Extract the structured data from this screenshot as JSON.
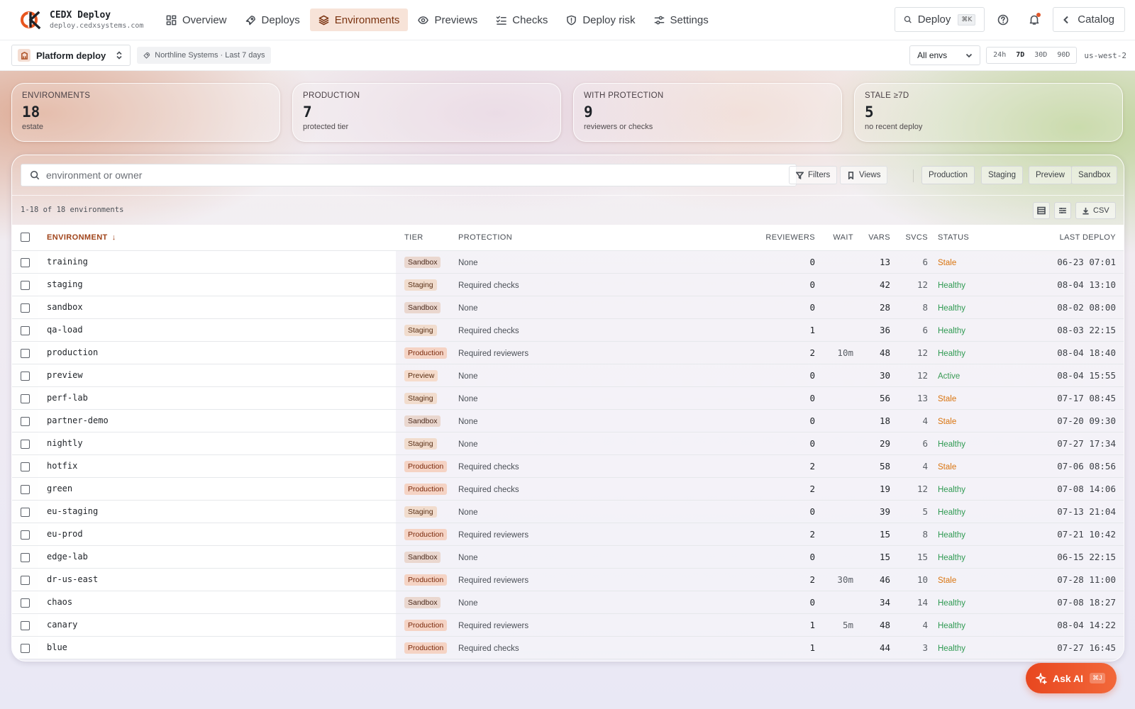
{
  "brand": {
    "title": "CEDX Deploy",
    "url": "deploy.cedxsystems.com"
  },
  "nav": {
    "items": [
      {
        "label": "Overview",
        "icon": "grid-icon"
      },
      {
        "label": "Deploys",
        "icon": "rocket-icon"
      },
      {
        "label": "Environments",
        "icon": "layers-icon",
        "active": true
      },
      {
        "label": "Previews",
        "icon": "eye-icon"
      },
      {
        "label": "Checks",
        "icon": "checklist-icon"
      },
      {
        "label": "Deploy risk",
        "icon": "shield-icon"
      },
      {
        "label": "Settings",
        "icon": "sliders-icon"
      }
    ],
    "command_label": "Deploy",
    "command_shortcut": "⌘K",
    "catalog_label": "Catalog"
  },
  "subbar": {
    "project": "Platform deploy",
    "scope": "Northline Systems · Last 7 days",
    "env_filter": "All envs",
    "ranges": [
      "24h",
      "7D",
      "30D",
      "90D"
    ],
    "active_range": "7D",
    "region": "us-west-2"
  },
  "stats": [
    {
      "label": "Environments",
      "value": "18",
      "sub": "estate"
    },
    {
      "label": "Production",
      "value": "7",
      "sub": "protected tier"
    },
    {
      "label": "With protection",
      "value": "9",
      "sub": "reviewers or checks"
    },
    {
      "label": "Stale ≥7D",
      "value": "5",
      "sub": "no recent deploy"
    }
  ],
  "toolbar": {
    "search_placeholder": "environment or owner",
    "filters_label": "Filters",
    "views_label": "Views",
    "chips": [
      "Production",
      "Staging",
      "Preview",
      "Sandbox"
    ],
    "count_text": "1-18 of 18 environments",
    "csv_label": "CSV"
  },
  "table": {
    "columns": {
      "environment": "Environment",
      "tier": "Tier",
      "protection": "Protection",
      "reviewers": "Reviewers",
      "wait": "Wait",
      "vars": "Vars",
      "svcs": "Svcs",
      "status": "Status",
      "last_deploy": "Last deploy"
    },
    "sort_arrow": "↓",
    "rows": [
      {
        "env": "training",
        "tier": "Sandbox",
        "protection": "None",
        "reviewers": "0",
        "wait": "",
        "vars": "13",
        "svcs": "6",
        "status": "Stale",
        "last": "06-23 07:01"
      },
      {
        "env": "staging",
        "tier": "Staging",
        "protection": "Required checks",
        "reviewers": "0",
        "wait": "",
        "vars": "42",
        "svcs": "12",
        "status": "Healthy",
        "last": "08-04 13:10"
      },
      {
        "env": "sandbox",
        "tier": "Sandbox",
        "protection": "None",
        "reviewers": "0",
        "wait": "",
        "vars": "28",
        "svcs": "8",
        "status": "Healthy",
        "last": "08-02 08:00"
      },
      {
        "env": "qa-load",
        "tier": "Staging",
        "protection": "Required checks",
        "reviewers": "1",
        "wait": "",
        "vars": "36",
        "svcs": "6",
        "status": "Healthy",
        "last": "08-03 22:15"
      },
      {
        "env": "production",
        "tier": "Production",
        "protection": "Required reviewers",
        "reviewers": "2",
        "wait": "10m",
        "vars": "48",
        "svcs": "12",
        "status": "Healthy",
        "last": "08-04 18:40"
      },
      {
        "env": "preview",
        "tier": "Preview",
        "protection": "None",
        "reviewers": "0",
        "wait": "",
        "vars": "30",
        "svcs": "12",
        "status": "Active",
        "last": "08-04 15:55"
      },
      {
        "env": "perf-lab",
        "tier": "Staging",
        "protection": "None",
        "reviewers": "0",
        "wait": "",
        "vars": "56",
        "svcs": "13",
        "status": "Stale",
        "last": "07-17 08:45"
      },
      {
        "env": "partner-demo",
        "tier": "Sandbox",
        "protection": "None",
        "reviewers": "0",
        "wait": "",
        "vars": "18",
        "svcs": "4",
        "status": "Stale",
        "last": "07-20 09:30"
      },
      {
        "env": "nightly",
        "tier": "Staging",
        "protection": "None",
        "reviewers": "0",
        "wait": "",
        "vars": "29",
        "svcs": "6",
        "status": "Healthy",
        "last": "07-27 17:34"
      },
      {
        "env": "hotfix",
        "tier": "Production",
        "protection": "Required checks",
        "reviewers": "2",
        "wait": "",
        "vars": "58",
        "svcs": "4",
        "status": "Stale",
        "last": "07-06 08:56"
      },
      {
        "env": "green",
        "tier": "Production",
        "protection": "Required checks",
        "reviewers": "2",
        "wait": "",
        "vars": "19",
        "svcs": "12",
        "status": "Healthy",
        "last": "07-08 14:06"
      },
      {
        "env": "eu-staging",
        "tier": "Staging",
        "protection": "None",
        "reviewers": "0",
        "wait": "",
        "vars": "39",
        "svcs": "5",
        "status": "Healthy",
        "last": "07-13 21:04"
      },
      {
        "env": "eu-prod",
        "tier": "Production",
        "protection": "Required reviewers",
        "reviewers": "2",
        "wait": "",
        "vars": "15",
        "svcs": "8",
        "status": "Healthy",
        "last": "07-21 10:42"
      },
      {
        "env": "edge-lab",
        "tier": "Sandbox",
        "protection": "None",
        "reviewers": "0",
        "wait": "",
        "vars": "15",
        "svcs": "15",
        "status": "Healthy",
        "last": "06-15 22:15"
      },
      {
        "env": "dr-us-east",
        "tier": "Production",
        "protection": "Required reviewers",
        "reviewers": "2",
        "wait": "30m",
        "vars": "46",
        "svcs": "10",
        "status": "Stale",
        "last": "07-28 11:00"
      },
      {
        "env": "chaos",
        "tier": "Sandbox",
        "protection": "None",
        "reviewers": "0",
        "wait": "",
        "vars": "34",
        "svcs": "14",
        "status": "Healthy",
        "last": "07-08 18:27"
      },
      {
        "env": "canary",
        "tier": "Production",
        "protection": "Required reviewers",
        "reviewers": "1",
        "wait": "5m",
        "vars": "48",
        "svcs": "4",
        "status": "Healthy",
        "last": "08-04 14:22"
      },
      {
        "env": "blue",
        "tier": "Production",
        "protection": "Required checks",
        "reviewers": "1",
        "wait": "",
        "vars": "44",
        "svcs": "3",
        "status": "Healthy",
        "last": "07-27 16:45"
      }
    ]
  },
  "ask_ai": {
    "label": "Ask AI",
    "shortcut": "⌘J"
  },
  "colors": {
    "accent": "#e8471f",
    "stale": "#d9730d",
    "healthy": "#2f9a52",
    "active_nav_bg": "#f7e3d8"
  }
}
